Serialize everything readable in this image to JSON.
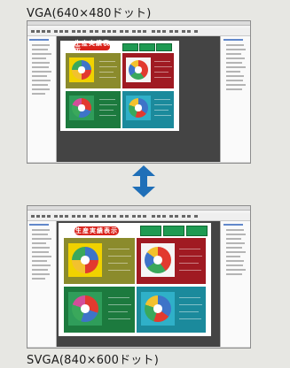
{
  "captions": {
    "top": "VGA(640×480ドット)",
    "bottom": "SVGA(840×600ドット)"
  },
  "screens": {
    "vga": {
      "display_title": "生産実績表示",
      "nav_buttons": [
        "",
        "",
        ""
      ],
      "panel_colors": [
        "#8b8b2c",
        "#a01a22",
        "#1c7a3e",
        "#1b8a9c"
      ],
      "donut_frame_colors": [
        "#f0d200",
        "#f5f5f5",
        "#2f9d5a",
        "#2fb0c8"
      ]
    },
    "svga": {
      "display_title": "生産実績表示",
      "nav_buttons": [
        "",
        "",
        ""
      ],
      "panel_colors": [
        "#8b8b2c",
        "#a01a22",
        "#1c7a3e",
        "#1b8a9c"
      ],
      "donut_frame_colors": [
        "#f0d200",
        "#f5f5f5",
        "#2f9d5a",
        "#2fb0c8"
      ]
    }
  },
  "icons": {
    "arrow": "up-down-arrow-icon"
  },
  "colors": {
    "arrow": "#1f6fb8",
    "title_pill": "#d9221b",
    "nav_button": "#1e9a52"
  }
}
